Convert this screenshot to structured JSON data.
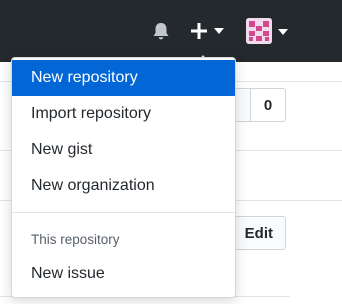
{
  "header": {
    "notifications_icon": "bell-icon",
    "create_icon": "plus-icon",
    "create_caret_icon": "caret-down-icon",
    "avatar_icon": "identicon-avatar",
    "avatar_caret_icon": "caret-down-icon"
  },
  "menu": {
    "items": [
      {
        "label": "New repository"
      },
      {
        "label": "Import repository"
      },
      {
        "label": "New gist"
      },
      {
        "label": "New organization"
      }
    ],
    "section_header": "This repository",
    "section_items": [
      {
        "label": "New issue"
      }
    ]
  },
  "background": {
    "counter_value": "0",
    "edit_label": "Edit"
  },
  "colors": {
    "header_bg": "#24292e",
    "active_item_bg": "#0366d6",
    "avatar_color": "#d1498f"
  }
}
